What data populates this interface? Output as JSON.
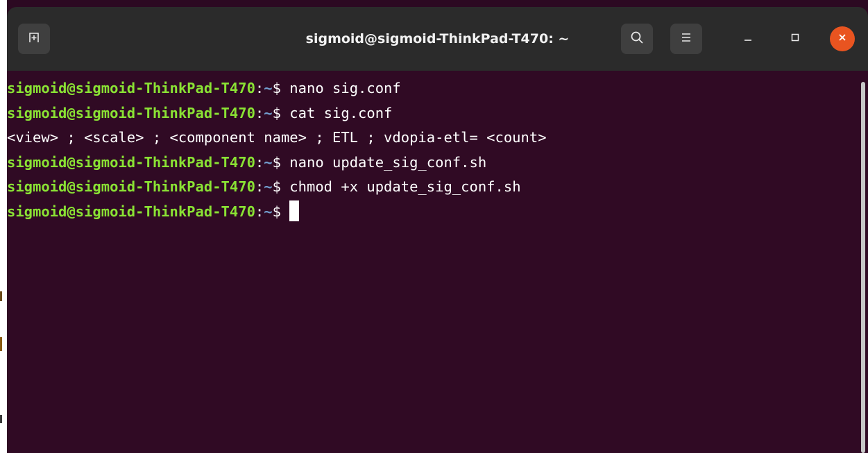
{
  "window": {
    "title": "sigmoid@sigmoid-ThinkPad-T470: ~"
  },
  "titlebar": {
    "new_tab_icon": "new-tab-icon",
    "search_icon": "search-icon",
    "menu_icon": "hamburger-menu-icon",
    "minimize_icon": "minimize-icon",
    "maximize_icon": "maximize-icon",
    "close_icon": "close-icon",
    "close_color": "#e95420"
  },
  "terminal": {
    "colors": {
      "background": "#300a24",
      "user_host": "#8ae234",
      "path": "#729fcf",
      "text": "#ffffff"
    },
    "lines": [
      {
        "prompt": "sigmoid@sigmoid-ThinkPad-T470",
        "sep": ":",
        "path": "~",
        "dollar": "$ ",
        "command": "nano sig.conf"
      },
      {
        "prompt": "sigmoid@sigmoid-ThinkPad-T470",
        "sep": ":",
        "path": "~",
        "dollar": "$ ",
        "command": "cat sig.conf"
      },
      {
        "output": "<view> ; <scale> ; <component name> ; ETL ; vdopia-etl= <count>"
      },
      {
        "prompt": "sigmoid@sigmoid-ThinkPad-T470",
        "sep": ":",
        "path": "~",
        "dollar": "$ ",
        "command": "nano update_sig_conf.sh"
      },
      {
        "prompt": "sigmoid@sigmoid-ThinkPad-T470",
        "sep": ":",
        "path": "~",
        "dollar": "$ ",
        "command": "chmod +x update_sig_conf.sh"
      },
      {
        "prompt": "sigmoid@sigmoid-ThinkPad-T470",
        "sep": ":",
        "path": "~",
        "dollar": "$ ",
        "command": ""
      }
    ]
  }
}
